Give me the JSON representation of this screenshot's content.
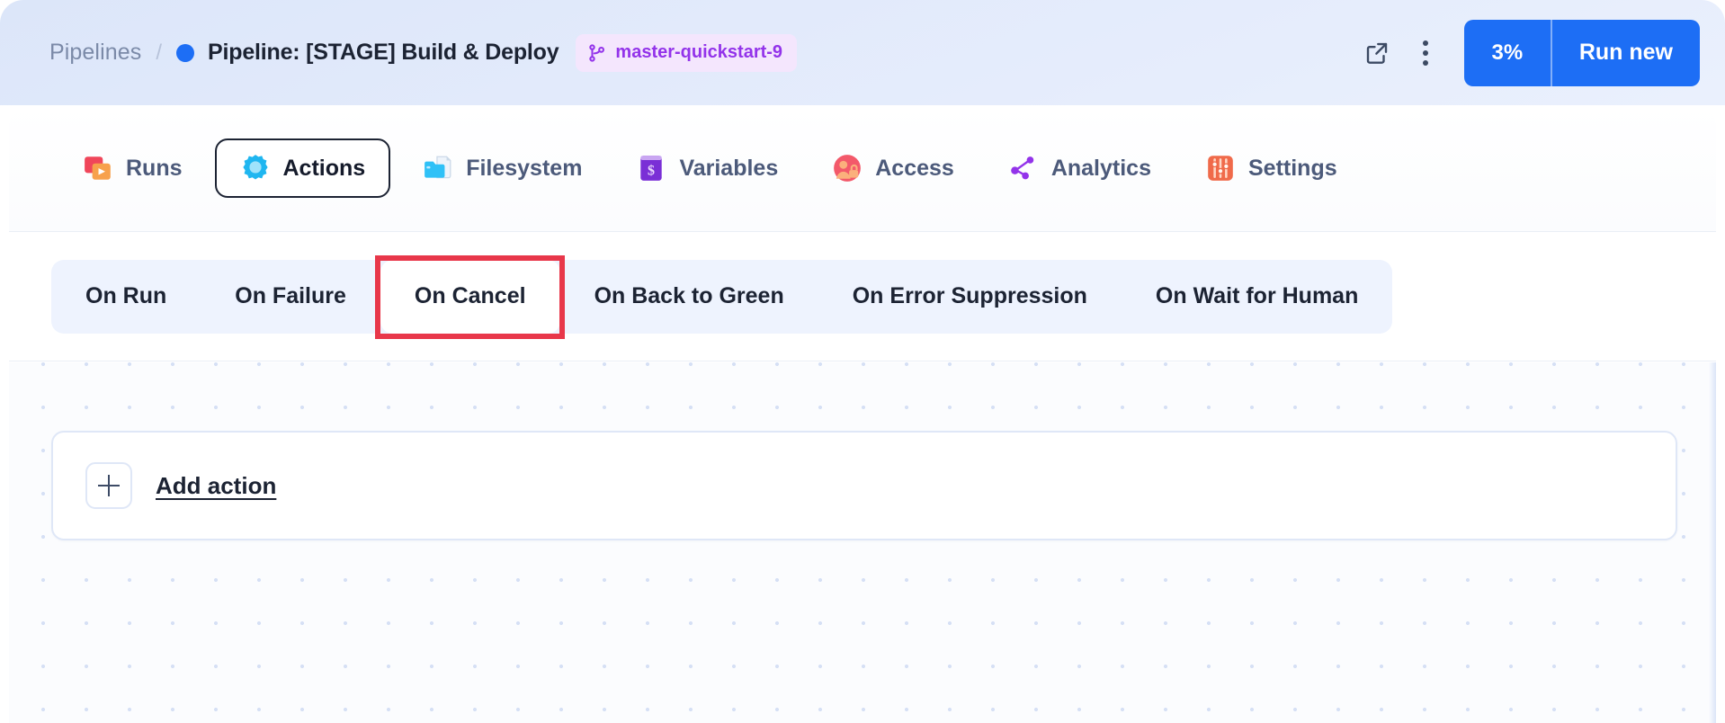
{
  "header": {
    "breadcrumb_root": "Pipelines",
    "breadcrumb_separator": "/",
    "status_dot_color": "#1d6ef5",
    "page_title": "Pipeline: [STAGE] Build & Deploy",
    "branch_badge": {
      "label": "master-quickstart-9",
      "icon": "git-branch-icon",
      "bg": "#f4e6fd",
      "fg": "#9333ea"
    },
    "open_external_icon": "external-link-icon",
    "more_icon": "kebab-menu-icon",
    "run_percent": "3%",
    "run_new_label": "Run new",
    "accent": "#1d6ef5"
  },
  "tabs": [
    {
      "label": "Runs",
      "icon": "runs-icon",
      "active": false
    },
    {
      "label": "Actions",
      "icon": "actions-gear-icon",
      "active": true
    },
    {
      "label": "Filesystem",
      "icon": "filesystem-folder-icon",
      "active": false
    },
    {
      "label": "Variables",
      "icon": "variables-dollar-icon",
      "active": false
    },
    {
      "label": "Access",
      "icon": "access-users-icon",
      "active": false
    },
    {
      "label": "Analytics",
      "icon": "analytics-graph-icon",
      "active": false
    },
    {
      "label": "Settings",
      "icon": "settings-sliders-icon",
      "active": false
    }
  ],
  "subtabs": [
    {
      "label": "On Run",
      "selected": false
    },
    {
      "label": "On Failure",
      "selected": false
    },
    {
      "label": "On Cancel",
      "selected": true
    },
    {
      "label": "On Back to Green",
      "selected": false
    },
    {
      "label": "On Error Suppression",
      "selected": false
    },
    {
      "label": "On Wait for Human",
      "selected": false
    }
  ],
  "highlight": {
    "target": "On Cancel",
    "color": "#e8374a"
  },
  "canvas": {
    "add_action_label": "Add action",
    "plus_icon": "plus-icon"
  }
}
